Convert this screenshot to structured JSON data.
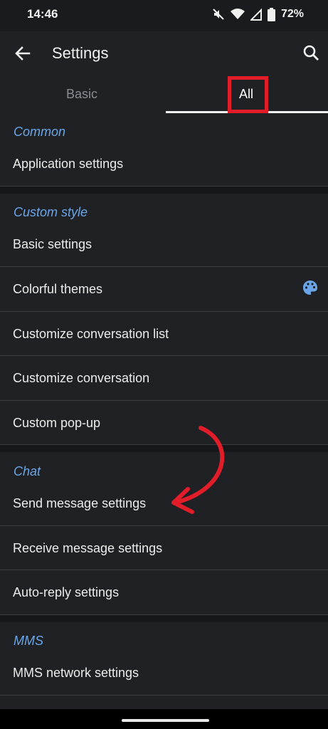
{
  "status_bar": {
    "time": "14:46",
    "battery": "72%"
  },
  "toolbar": {
    "title": "Settings"
  },
  "tabs": {
    "basic": "Basic",
    "all": "All"
  },
  "sections": {
    "common": {
      "header": "Common",
      "items": [
        "Application settings"
      ]
    },
    "custom_style": {
      "header": "Custom style",
      "items": [
        "Basic settings",
        "Colorful themes",
        "Customize conversation list",
        "Customize conversation",
        "Custom pop-up"
      ]
    },
    "chat": {
      "header": "Chat",
      "items": [
        "Send message settings",
        "Receive message settings",
        "Auto-reply settings"
      ]
    },
    "mms": {
      "header": "MMS",
      "items": [
        "MMS network settings"
      ]
    }
  },
  "icons": {
    "back": "back-arrow-icon",
    "search": "search-icon",
    "palette": "palette-icon",
    "wifi": "wifi-icon",
    "signal": "signal-icon",
    "battery": "battery-icon",
    "mute": "mute-icon"
  },
  "colors": {
    "accent": "#6aa6e8",
    "highlight_box": "#e11d2a",
    "background": "#1f2124"
  }
}
